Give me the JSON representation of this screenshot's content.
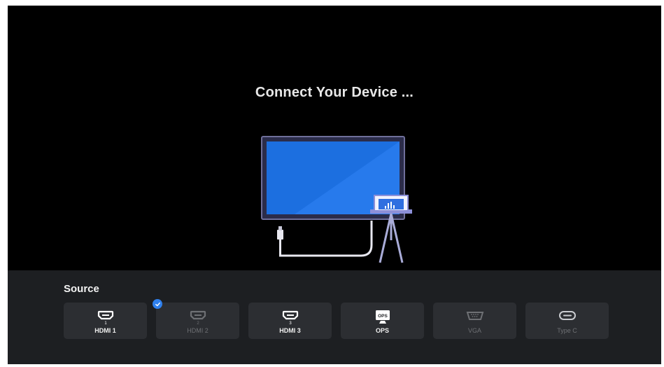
{
  "screen": {
    "title": "Connect Your Device ..."
  },
  "source_panel": {
    "label": "Source",
    "items": [
      {
        "label": "HDMI 1",
        "port_number": "1",
        "icon": "hdmi-icon",
        "available": true,
        "selected": false
      },
      {
        "label": "HDMI 2",
        "port_number": "2",
        "icon": "hdmi-icon",
        "available": false,
        "selected": true
      },
      {
        "label": "HDMI 3",
        "port_number": "3",
        "icon": "hdmi-icon",
        "available": true,
        "selected": false
      },
      {
        "label": "OPS",
        "icon_text": "OPS",
        "icon": "ops-icon",
        "available": true,
        "selected": false
      },
      {
        "label": "VGA",
        "icon": "vga-icon",
        "available": false,
        "selected": false
      },
      {
        "label": "Type C",
        "icon": "type-c-icon",
        "available": false,
        "selected": false
      }
    ]
  },
  "colors": {
    "background": "#000000",
    "panel": "#1d1f22",
    "tile": "#2c2e32",
    "accent": "#2f80ed",
    "screen_blue": "#1c6fe0",
    "dim_text": "#6e7074"
  }
}
